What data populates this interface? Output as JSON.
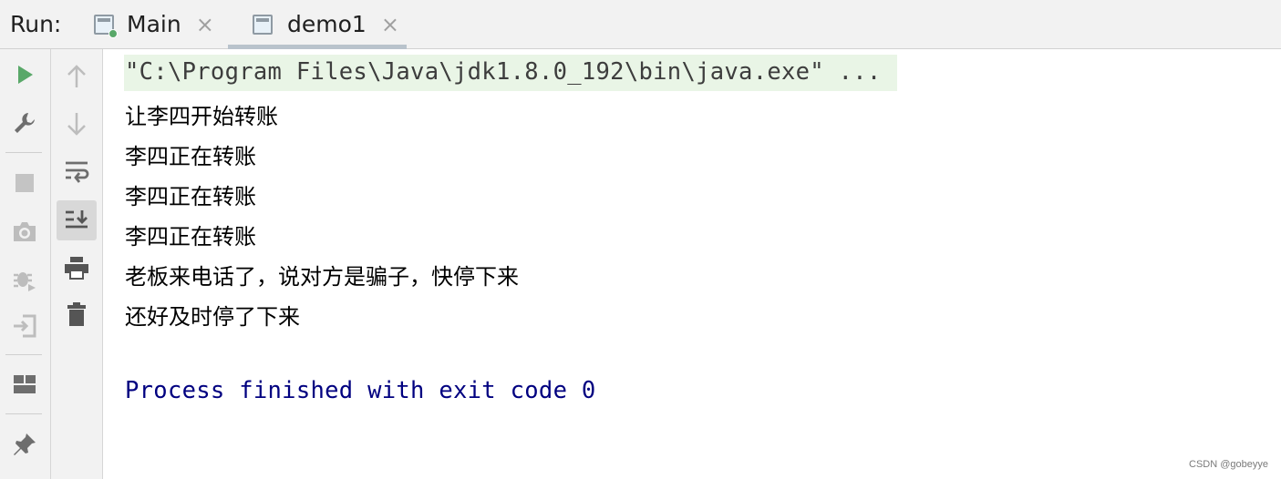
{
  "header": {
    "run_label": "Run:",
    "tabs": [
      {
        "label": "Main",
        "close": "×"
      },
      {
        "label": "demo1",
        "close": "×"
      }
    ]
  },
  "toolbar_left": [
    "run-icon",
    "wrench-icon",
    "stop-icon",
    "camera-icon",
    "debug-icon",
    "login-icon",
    "layout-icon",
    "pin-icon"
  ],
  "toolbar_right": [
    "arrow-up-icon",
    "arrow-down-icon",
    "soft-wrap-icon",
    "scroll-to-end-icon",
    "print-icon",
    "trash-icon"
  ],
  "console": {
    "command": "\"C:\\Program Files\\Java\\jdk1.8.0_192\\bin\\java.exe\" ...",
    "lines": [
      "让李四开始转账",
      "李四正在转账",
      "李四正在转账",
      "李四正在转账",
      "老板来电话了，说对方是骗子，快停下来",
      "还好及时停了下来"
    ],
    "exit": "Process finished with exit code 0"
  },
  "watermark": "CSDN @gobeyye",
  "colors": {
    "command_bg": "#e9f5e6",
    "exit_text": "#000080",
    "run_green": "#59a869"
  }
}
